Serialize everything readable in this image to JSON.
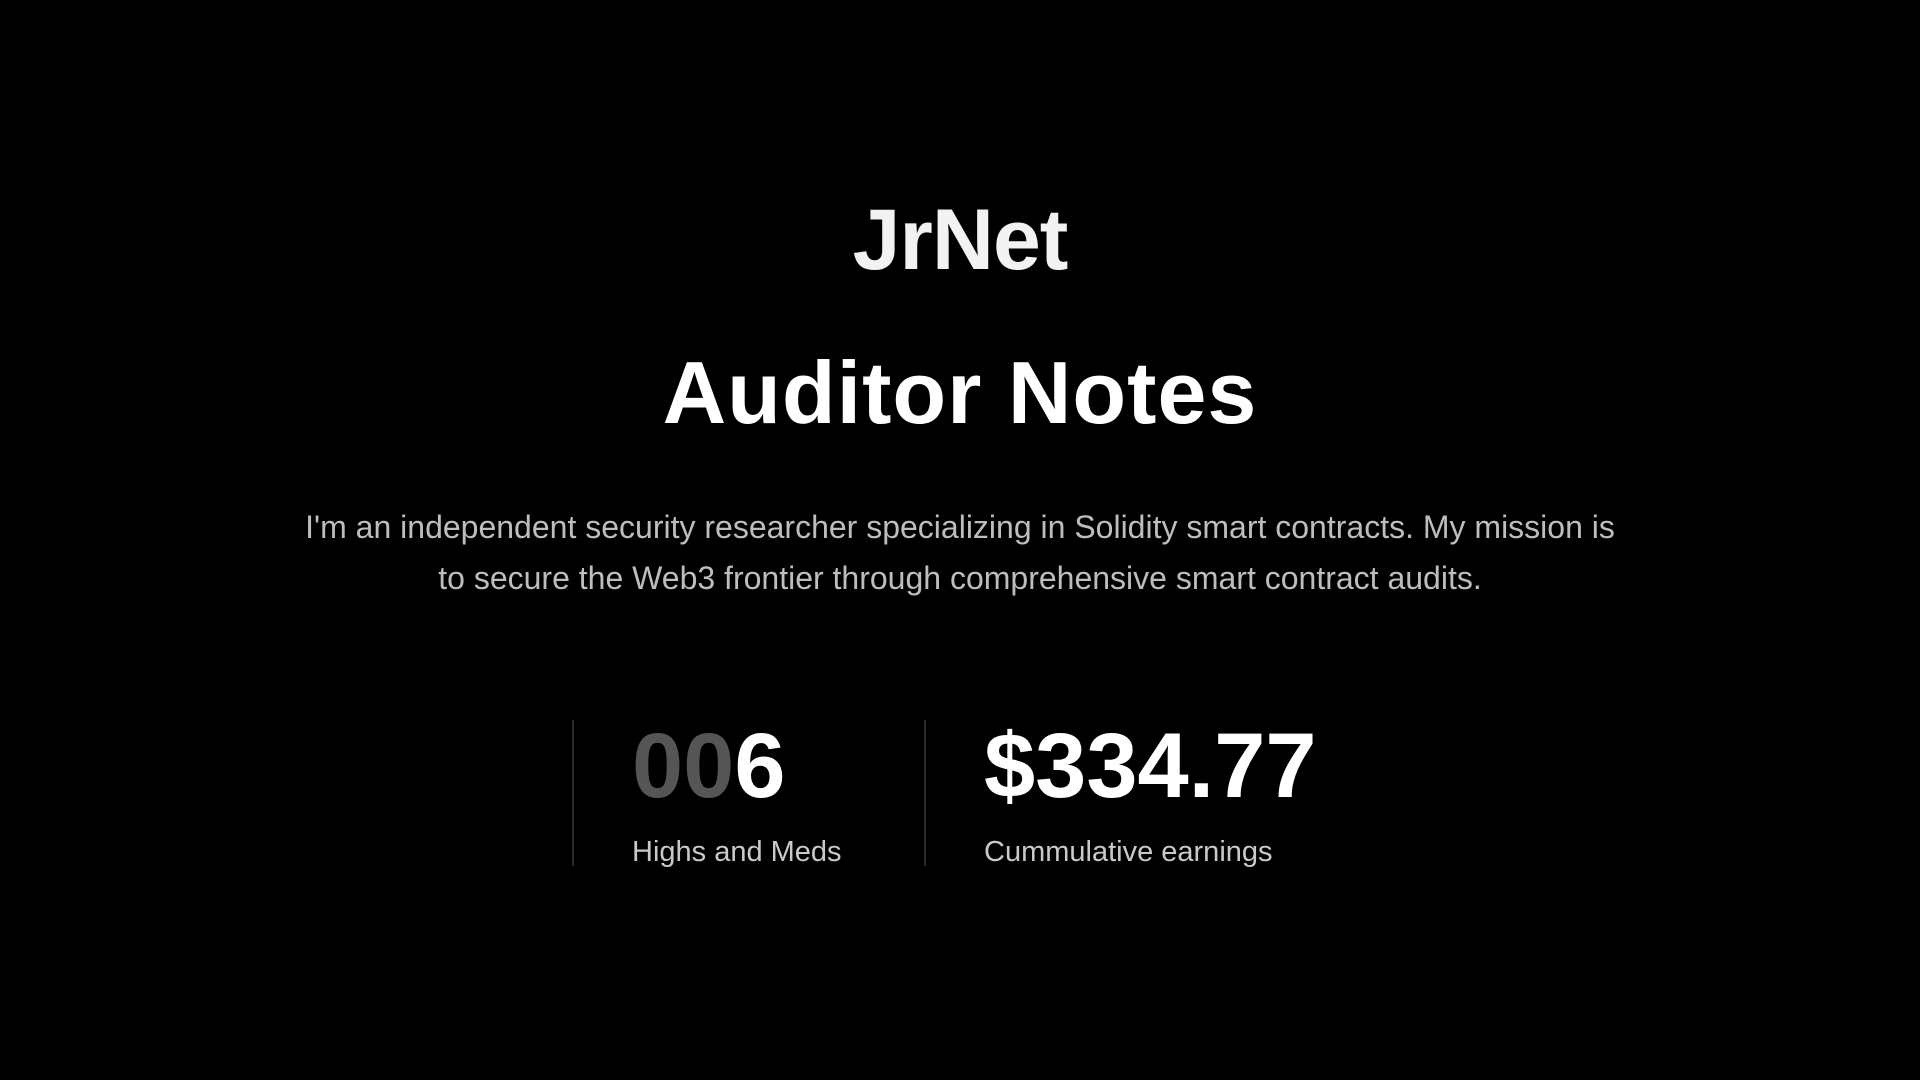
{
  "header": {
    "brand": "JrNet",
    "title": "Auditor Notes"
  },
  "intro": {
    "text": "I'm an independent security researcher specializing in Solidity smart contracts. My mission is to secure the Web3 frontier through comprehensive smart contract audits."
  },
  "stats": {
    "highs_meds": {
      "value_padding": "00",
      "value": "6",
      "label": "Highs and Meds"
    },
    "earnings": {
      "value": "$334.77",
      "label": "Cummulative earnings"
    }
  },
  "colors": {
    "background": "#000000",
    "heading": "#ffffff",
    "body_text": "#bdbdbd",
    "muted_digits": "#555555",
    "divider": "#262b33"
  }
}
